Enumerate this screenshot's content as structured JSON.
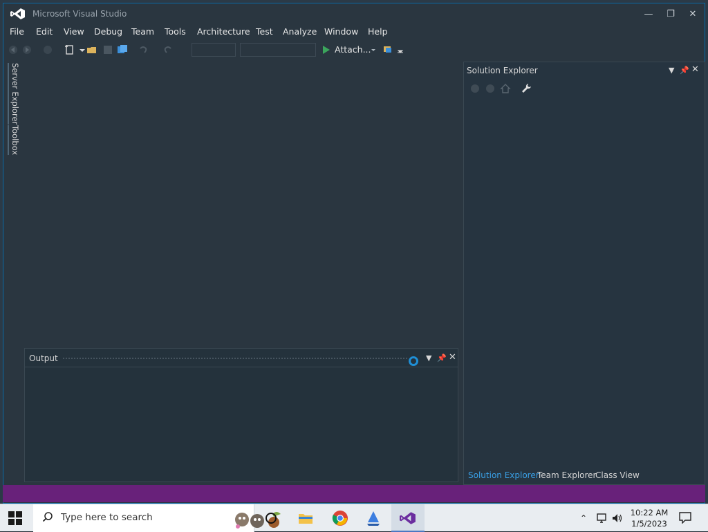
{
  "app": {
    "title": "Microsoft Visual Studio"
  },
  "menu": [
    "File",
    "Edit",
    "View",
    "Debug",
    "Team",
    "Tools",
    "Architecture",
    "Test",
    "Analyze",
    "Window",
    "Help"
  ],
  "toolbar": {
    "attach_label": "Attach..."
  },
  "side_tabs": {
    "server_explorer": "Server Explorer",
    "toolbox": "Toolbox"
  },
  "output_panel": {
    "title": "Output"
  },
  "solution_panel": {
    "title": "Solution Explorer",
    "tabs": [
      "Solution Explorer",
      "Team Explorer",
      "Class View"
    ]
  },
  "taskbar": {
    "search_placeholder": "Type here to search",
    "time": "10:22 AM",
    "date": "1/5/2023"
  },
  "colors": {
    "accent": "#1f8fd6",
    "status_bar": "#68217a",
    "window_border": "#0a6aa6"
  }
}
